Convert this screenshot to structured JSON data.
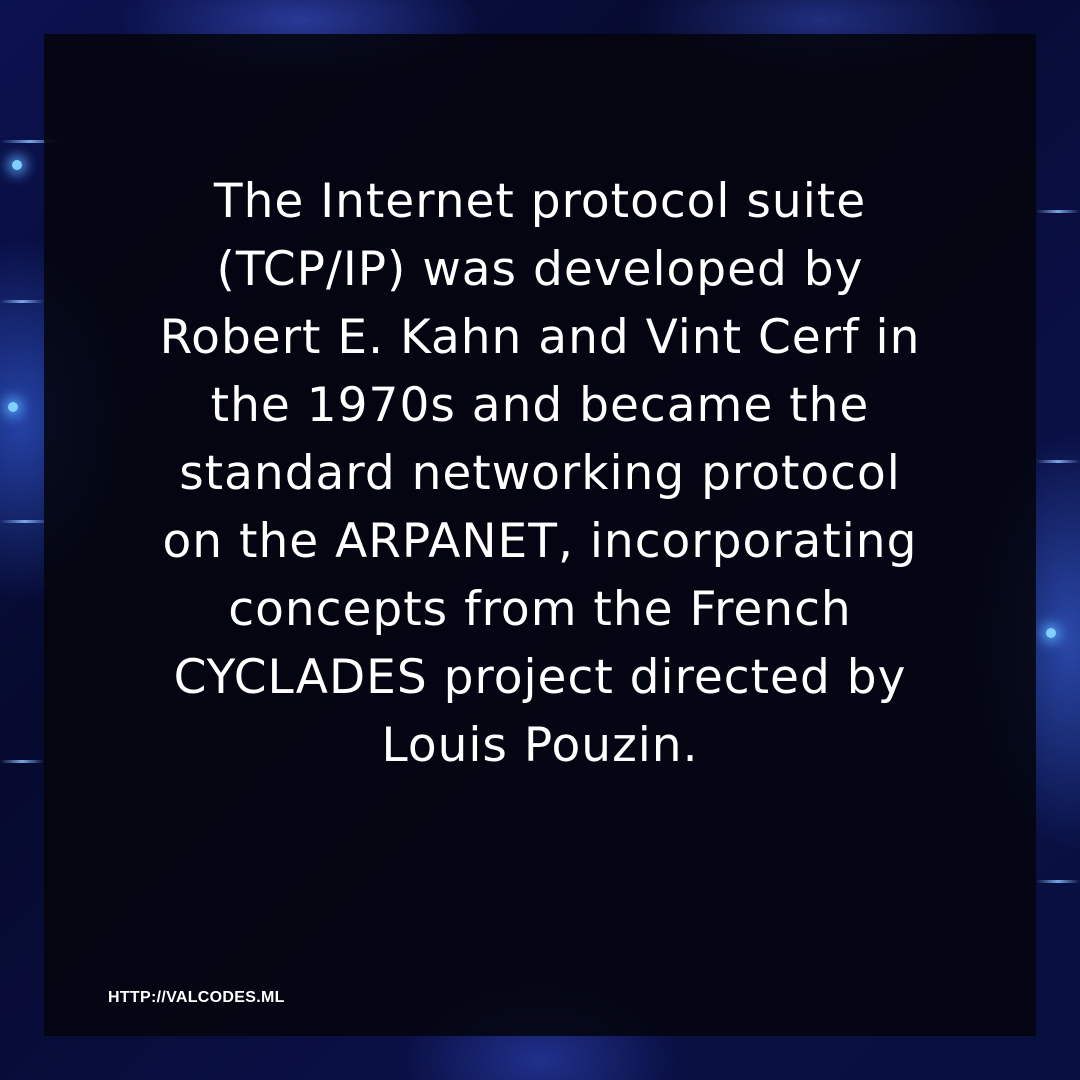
{
  "quote": {
    "lines": [
      "The Internet protocol suite",
      "(TCP/IP) was developed by",
      "Robert E. Kahn and Vint Cerf in",
      "the 1970s and became the",
      "standard networking protocol",
      "on the ARPANET, incorporating",
      "concepts from the French",
      "CYCLADES project directed by",
      "Louis Pouzin."
    ]
  },
  "footer": {
    "url": "HTTP://VALCODES.ML"
  },
  "colors": {
    "text": "#ffffff",
    "panel": "#04050c",
    "glow": "#7fd0ff"
  }
}
